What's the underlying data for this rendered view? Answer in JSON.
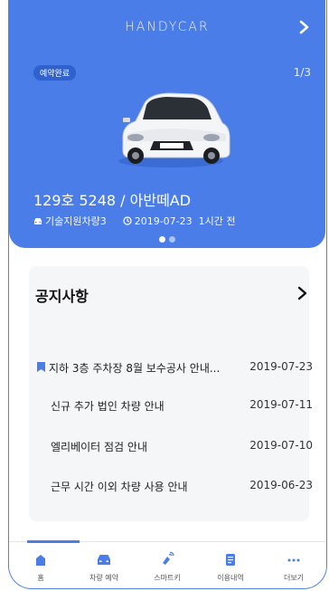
{
  "hero": {
    "brand": "HANDYCAR",
    "badge": "예약완료",
    "counter": "1/3",
    "plate": "129호 5248 / 아반떼AD",
    "vehicle_type": "기술지원차량3",
    "datetime": "2019-07-23  1시간 전",
    "dots": [
      {
        "active": true
      },
      {
        "active": false
      }
    ]
  },
  "notice": {
    "title": "공지사항",
    "items": [
      {
        "title": "지하 3층 주차장 8월 보수공사 안내...",
        "date": "2019-07-23",
        "flagged": true
      },
      {
        "title": "신규 추가 법인 차량 안내",
        "date": "2019-07-11",
        "flagged": false
      },
      {
        "title": "엘리베이터 점검 안내",
        "date": "2019-07-10",
        "flagged": false
      },
      {
        "title": "근무 시간 이외 차량 사용 안내",
        "date": "2019-06-23",
        "flagged": false
      }
    ]
  },
  "tabs": [
    {
      "label": "홈",
      "icon": "home-icon",
      "active": true
    },
    {
      "label": "차량 예약",
      "icon": "car-icon",
      "active": false
    },
    {
      "label": "스마트키",
      "icon": "smart-key-icon",
      "active": false
    },
    {
      "label": "이용내역",
      "icon": "history-icon",
      "active": false
    },
    {
      "label": "더보기",
      "icon": "more-icon",
      "active": false
    }
  ],
  "colors": {
    "primary": "#4a7de8",
    "badge": "#2f62cf",
    "dot_inactive": "#a9c3ff",
    "notice_bg": "#f5f6f8"
  }
}
